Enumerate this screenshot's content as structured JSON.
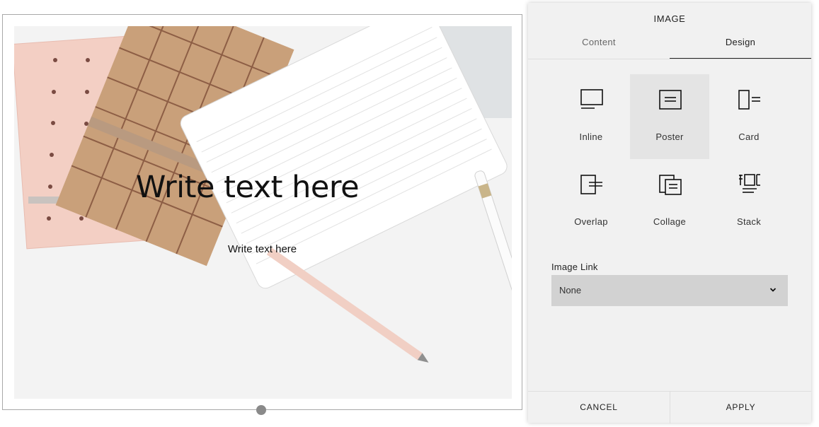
{
  "canvas": {
    "title_text": "Write text here",
    "subtitle_text": "Write text here"
  },
  "panel": {
    "title": "IMAGE",
    "tabs": [
      {
        "label": "Content",
        "active": false
      },
      {
        "label": "Design",
        "active": true
      }
    ],
    "layouts": [
      {
        "label": "Inline",
        "icon": "inline-layout-icon",
        "selected": false
      },
      {
        "label": "Poster",
        "icon": "poster-layout-icon",
        "selected": true
      },
      {
        "label": "Card",
        "icon": "card-layout-icon",
        "selected": false
      },
      {
        "label": "Overlap",
        "icon": "overlap-layout-icon",
        "selected": false
      },
      {
        "label": "Collage",
        "icon": "collage-layout-icon",
        "selected": false
      },
      {
        "label": "Stack",
        "icon": "stack-layout-icon",
        "selected": false
      }
    ],
    "image_link": {
      "label": "Image Link",
      "value": "None"
    },
    "footer": {
      "cancel_label": "CANCEL",
      "apply_label": "APPLY"
    }
  },
  "colors": {
    "panel_bg": "#f1f1f1",
    "selected_bg": "#e4e4e4",
    "select_bg": "#d2d2d2"
  }
}
